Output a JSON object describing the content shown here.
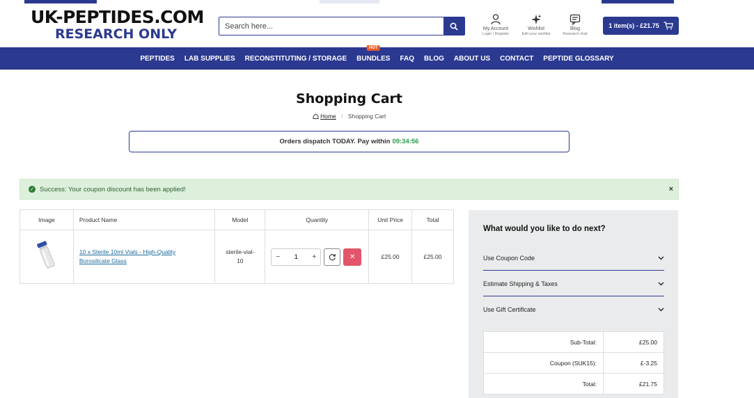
{
  "brand": {
    "line1": "UK-PEPTIDES.COM",
    "line2": "RESEARCH ONLY"
  },
  "search": {
    "placeholder": "Search here..."
  },
  "header_links": [
    {
      "label": "My Account",
      "sub": "Login / Register",
      "icon": "user-icon"
    },
    {
      "label": "Wishlist",
      "sub": "Edit your wishlist",
      "icon": "sparkle-icon"
    },
    {
      "label": "Blog",
      "sub": "Research Hub",
      "icon": "chat-icon"
    }
  ],
  "cart": {
    "label": "1 item(s) - £21.75",
    "icon": "cart-icon"
  },
  "nav": [
    {
      "label": "PEPTIDES"
    },
    {
      "label": "LAB SUPPLIES"
    },
    {
      "label": "RECONSTITUTING / STORAGE"
    },
    {
      "label": "BUNDLES",
      "badge": "HOT"
    },
    {
      "label": "FAQ"
    },
    {
      "label": "BLOG"
    },
    {
      "label": "ABOUT US"
    },
    {
      "label": "CONTACT"
    },
    {
      "label": "PEPTIDE GLOSSARY"
    }
  ],
  "page": {
    "title": "Shopping Cart",
    "breadcrumb": {
      "home": "Home",
      "sep": "/",
      "current": "Shopping Cart"
    }
  },
  "dispatch": {
    "text": "Orders dispatch TODAY. Pay within",
    "timer": "09:34:56"
  },
  "alert": {
    "text": "Success: Your coupon discount has been applied!",
    "close": "×"
  },
  "table": {
    "headers": [
      "Image",
      "Product Name",
      "Model",
      "Quantity",
      "Unit Price",
      "Total"
    ],
    "rows": [
      {
        "name_line1": "10 x Sterile 10ml Vials - High-Quality",
        "name_line2": "Borosilicate Glass",
        "model_line1": "sterile-vial-",
        "model_line2": "10",
        "quantity": "1",
        "unit_price": "£25.00",
        "total": "£25.00"
      }
    ],
    "qty_minus": "−",
    "qty_plus": "+"
  },
  "next": {
    "title": "What would you like to do next?",
    "options": [
      "Use Coupon Code",
      "Estimate Shipping & Taxes",
      "Use Gift Certificate"
    ]
  },
  "totals": [
    {
      "label": "Sub-Total:",
      "value": "£25.00"
    },
    {
      "label": "Coupon (SUK15):",
      "value": "£-3.25"
    },
    {
      "label": "Total:",
      "value": "£21.75"
    }
  ],
  "colors": {
    "brand_blue": "#2b3990",
    "success_bg": "#dcf0dc",
    "remove_red": "#e2556a",
    "timer_green": "#2a9d4a",
    "hot_orange": "#e85a2a"
  }
}
